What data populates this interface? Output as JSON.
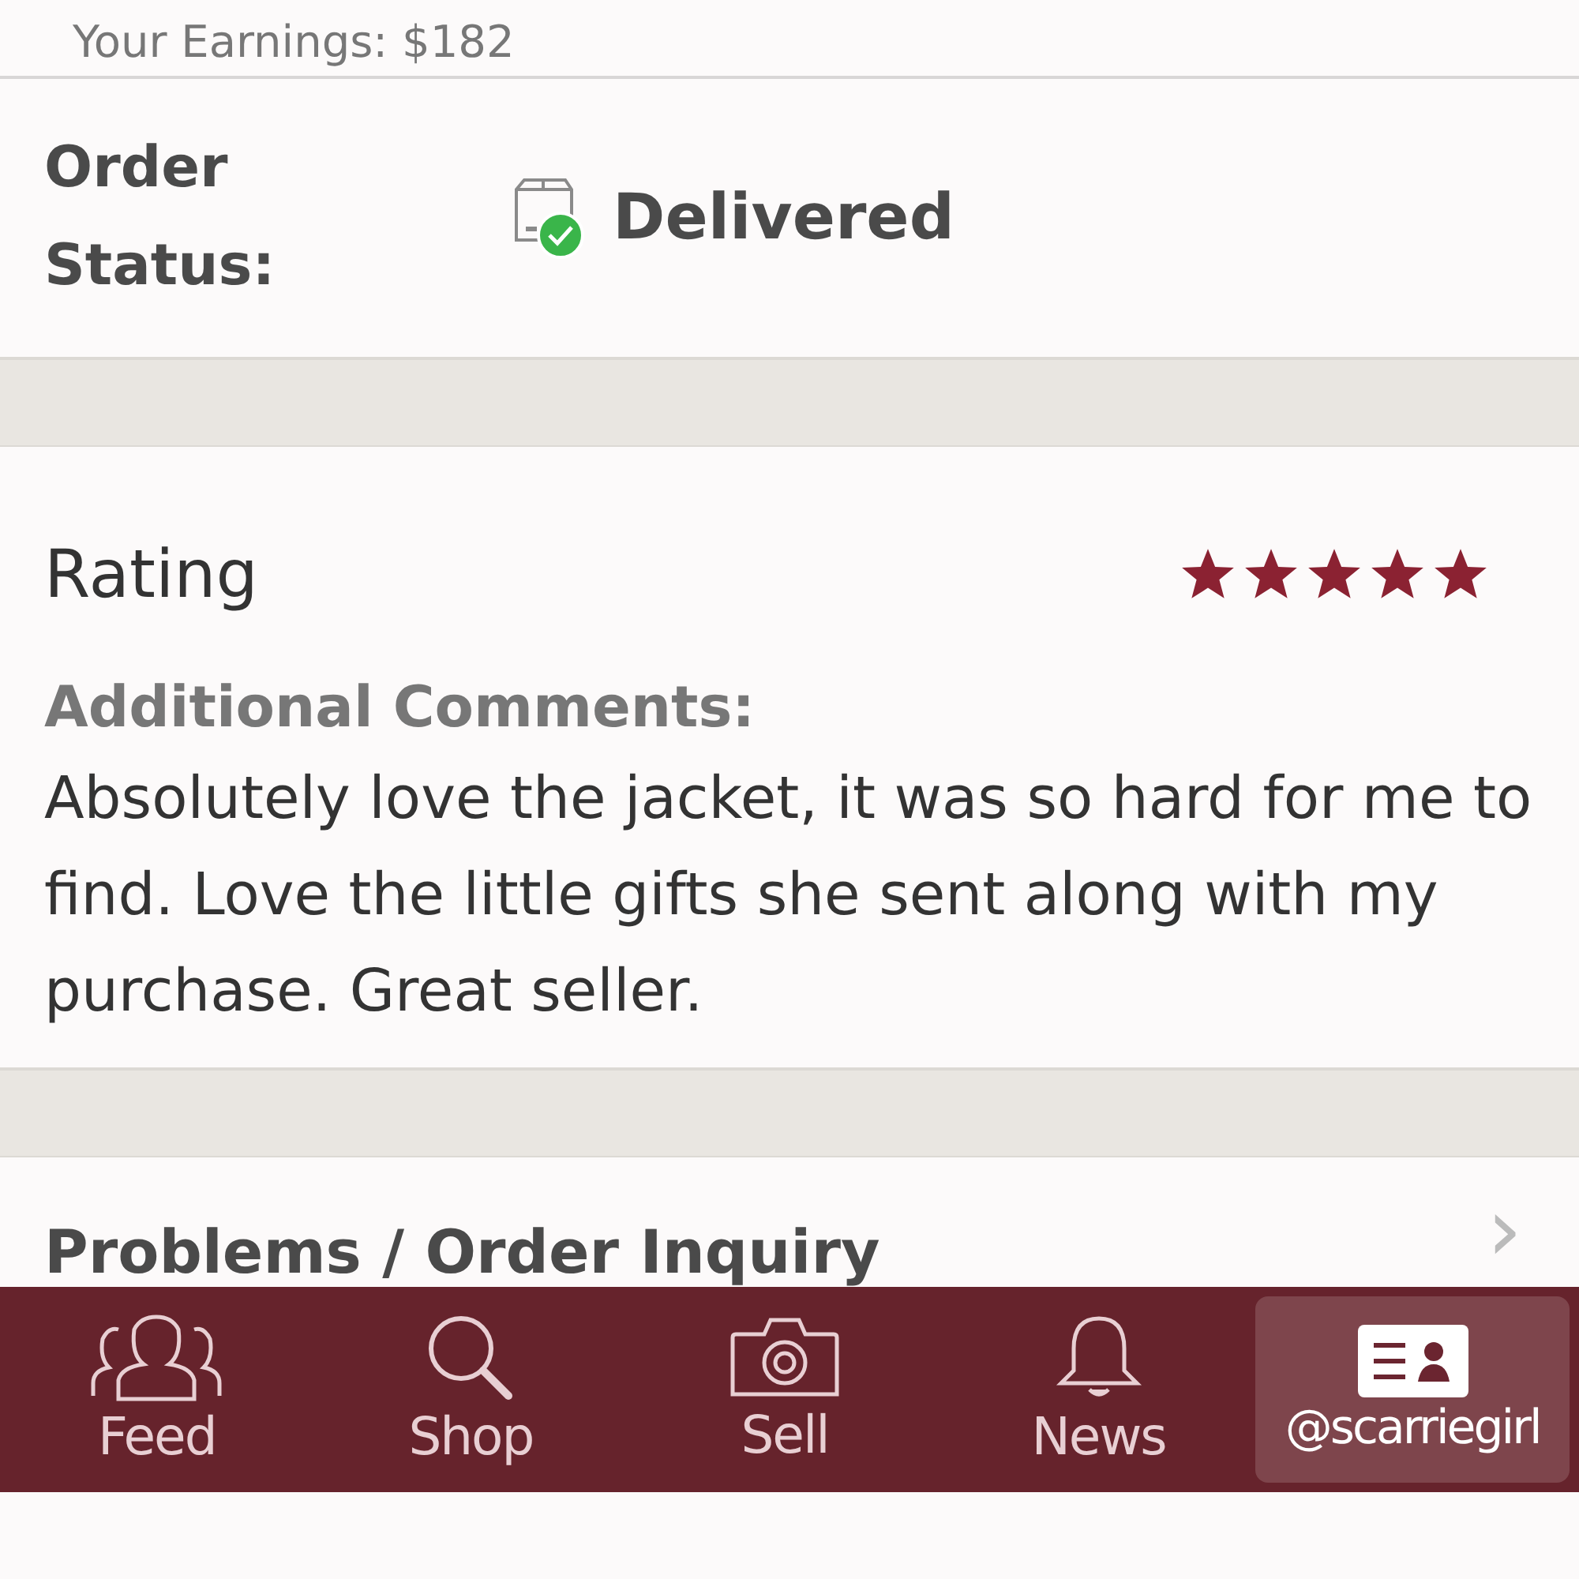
{
  "earnings": {
    "text": "Your Earnings: $182"
  },
  "order_status": {
    "label": "Order Status:",
    "value": "Delivered"
  },
  "rating": {
    "title": "Rating",
    "stars": 5,
    "comments_label": "Additional Comments:",
    "comments": "Absolutely love the jacket, it was so hard for me to find. Love the little gifts she sent along with my purchase. Great seller."
  },
  "problems": {
    "label": "Problems / Order Inquiry",
    "chevron": "›"
  },
  "tabs": [
    {
      "kind": "feed",
      "label": "Feed",
      "selected": false
    },
    {
      "kind": "shop",
      "label": "Shop",
      "selected": false
    },
    {
      "kind": "sell",
      "label": "Sell",
      "selected": false
    },
    {
      "kind": "news",
      "label": "News",
      "selected": false
    },
    {
      "kind": "profile",
      "label": "@scarriegirl",
      "selected": true
    }
  ]
}
